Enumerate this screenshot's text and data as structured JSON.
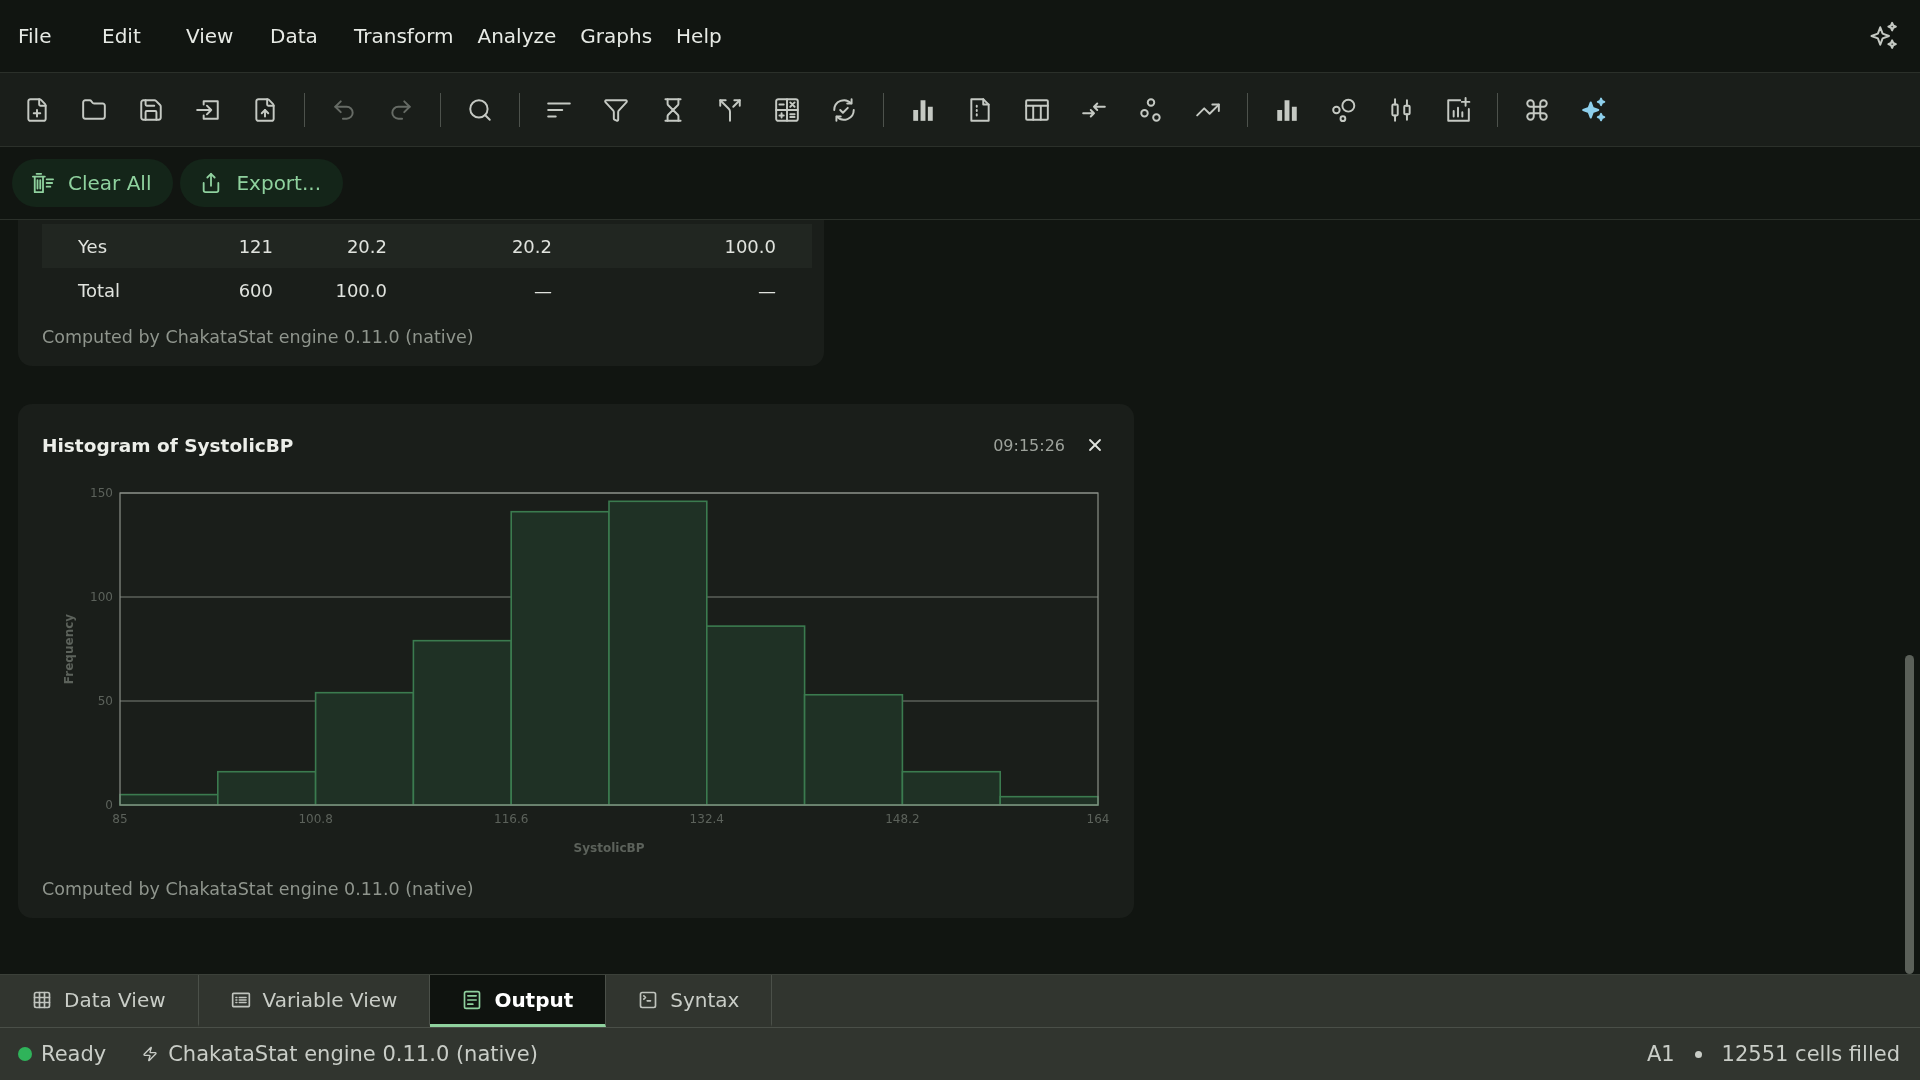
{
  "menu_bar": {
    "items": [
      "File",
      "Edit",
      "View",
      "Data",
      "Transform",
      "Analyze",
      "Graphs",
      "Help"
    ]
  },
  "toolbar": {
    "groups": [
      [
        {
          "kind": "file-plus",
          "disabled": false
        },
        {
          "kind": "folder",
          "disabled": false
        },
        {
          "kind": "save",
          "disabled": false
        },
        {
          "kind": "box-arrow-in",
          "disabled": false
        },
        {
          "kind": "file-up",
          "disabled": false
        }
      ],
      [
        {
          "kind": "undo",
          "disabled": true
        },
        {
          "kind": "redo",
          "disabled": true
        }
      ],
      [
        {
          "kind": "search",
          "disabled": false
        }
      ],
      [
        {
          "kind": "sort-lines",
          "disabled": false
        },
        {
          "kind": "funnel",
          "disabled": false
        },
        {
          "kind": "hourglass",
          "disabled": false
        },
        {
          "kind": "fork",
          "disabled": false
        },
        {
          "kind": "calculator",
          "disabled": false
        },
        {
          "kind": "refresh-check",
          "disabled": false
        }
      ],
      [
        {
          "kind": "bars",
          "disabled": false
        },
        {
          "kind": "file-dotted",
          "disabled": false
        },
        {
          "kind": "table",
          "disabled": false
        },
        {
          "kind": "arrows-in",
          "disabled": false
        },
        {
          "kind": "circles",
          "disabled": false
        },
        {
          "kind": "trend-up",
          "disabled": false
        }
      ],
      [
        {
          "kind": "bars",
          "disabled": false
        },
        {
          "kind": "bubbles",
          "disabled": false
        },
        {
          "kind": "candles",
          "disabled": false
        },
        {
          "kind": "chart-plus",
          "disabled": false
        }
      ],
      [
        {
          "kind": "command",
          "disabled": false
        },
        {
          "kind": "sparkles",
          "disabled": false
        }
      ]
    ]
  },
  "action_bar": {
    "buttons": [
      {
        "kind": "clear",
        "label": "Clear All"
      },
      {
        "kind": "export",
        "label": "Export..."
      }
    ]
  },
  "output": {
    "cards": [
      {
        "kind": "table",
        "rows": [
          {
            "cells": [
              "Yes",
              "121",
              "20.2",
              "20.2",
              "100.0"
            ]
          },
          {
            "cells": [
              "Total",
              "600",
              "100.0",
              "—",
              "—"
            ]
          }
        ],
        "note": "Computed by ChakataStat engine 0.11.0 (native)"
      },
      {
        "kind": "chart",
        "title": "Histogram of SystolicBP",
        "time": "09:15:26",
        "chart_data": {
          "type": "bar",
          "xlabel": "SystolicBP",
          "ylabel": "Frequency",
          "x": [
            88.95,
            96.85,
            104.75,
            112.65,
            120.55,
            128.45,
            136.35,
            144.25,
            152.15,
            160.05
          ],
          "values": [
            5,
            16,
            54,
            79,
            141,
            146,
            86,
            53,
            16,
            4
          ],
          "xlim": [
            85,
            164
          ],
          "ylim": [
            0,
            150
          ],
          "xticks": [
            85,
            100.8,
            116.6,
            132.4,
            148.2,
            164
          ],
          "yticks": [
            0,
            50,
            100,
            150
          ]
        },
        "note": "Computed by ChakataStat engine 0.11.0 (native)"
      }
    ]
  },
  "tabs": [
    {
      "kind": "grid",
      "label": "Data View",
      "selected": false
    },
    {
      "kind": "list",
      "label": "Variable View",
      "selected": false
    },
    {
      "kind": "document",
      "label": "Output",
      "selected": true
    },
    {
      "kind": "terminal",
      "label": "Syntax",
      "selected": false
    }
  ],
  "status_bar": {
    "state": "Ready",
    "engine": "ChakataStat engine 0.11.0 (native)",
    "cell": "A1",
    "cells_filled": "12551 cells filled"
  }
}
